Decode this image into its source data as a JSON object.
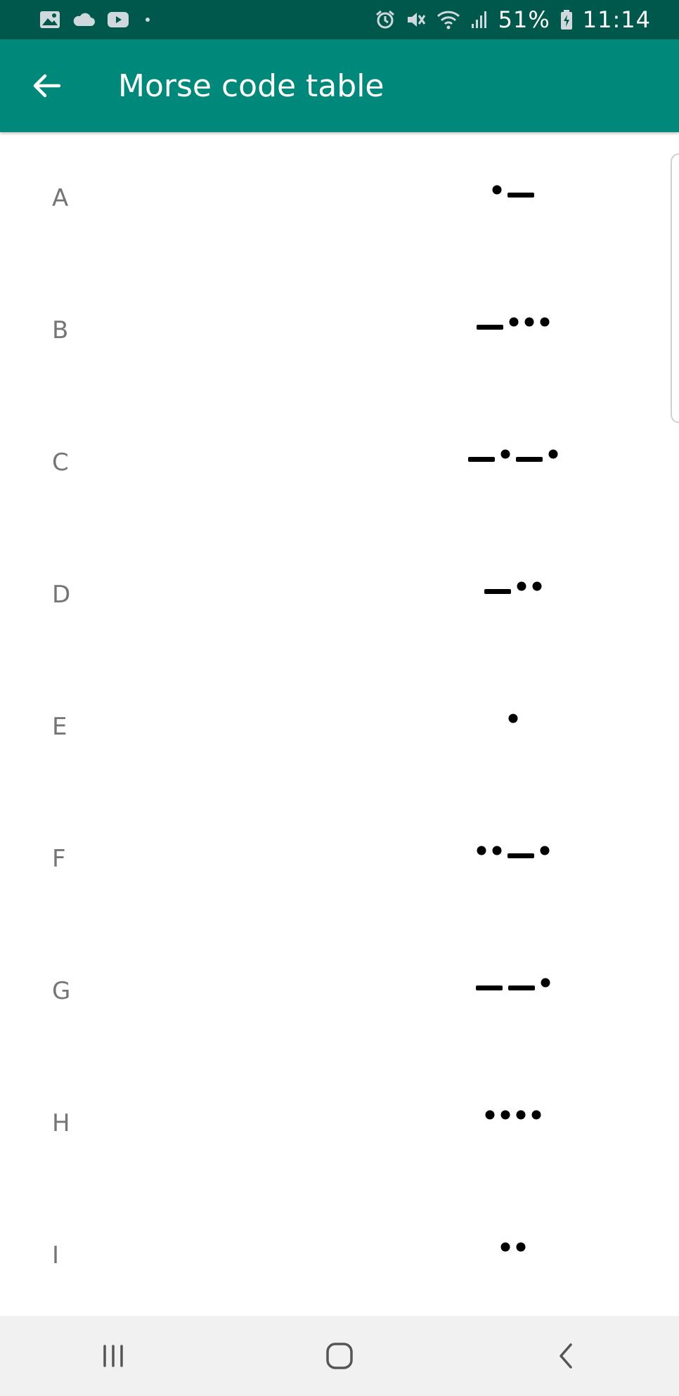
{
  "status_bar": {
    "battery": "51%",
    "time": "11:14",
    "icons": [
      "image-icon",
      "cloud-icon",
      "youtube-icon",
      "dot-icon",
      "alarm-icon",
      "mute-icon",
      "wifi-icon",
      "signal-icon",
      "battery-icon"
    ]
  },
  "app_bar": {
    "title": "Morse code table",
    "back_icon": "arrow-left-icon"
  },
  "colors": {
    "status_bar": "#00574b",
    "app_bar": "#00897b",
    "letter": "#757575",
    "morse": "#000000",
    "nav_bar": "#f1f1f1"
  },
  "rows": [
    {
      "letter": "A",
      "code": ".-"
    },
    {
      "letter": "B",
      "code": "-..."
    },
    {
      "letter": "C",
      "code": "-.-."
    },
    {
      "letter": "D",
      "code": "-.."
    },
    {
      "letter": "E",
      "code": "."
    },
    {
      "letter": "F",
      "code": "..-."
    },
    {
      "letter": "G",
      "code": "--."
    },
    {
      "letter": "H",
      "code": "...."
    },
    {
      "letter": "I",
      "code": ".."
    }
  ],
  "nav_bar": {
    "icons": [
      "recent-apps-icon",
      "home-icon",
      "back-icon"
    ]
  }
}
